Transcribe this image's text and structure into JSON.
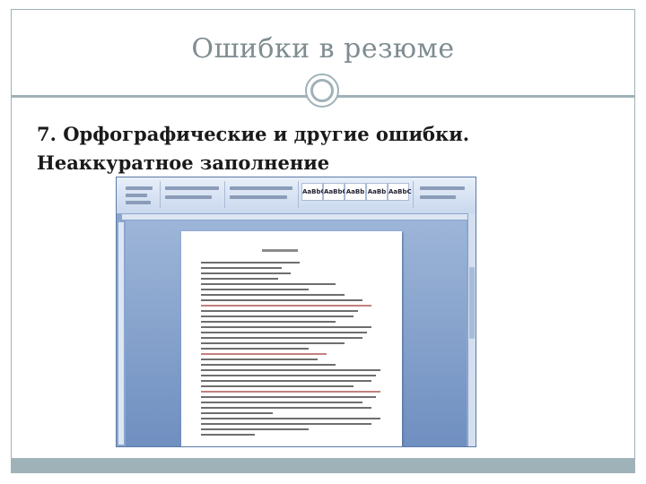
{
  "slide": {
    "title": "Ошибки в резюме",
    "heading_line1": "7. Орфографические и другие ошибки.",
    "heading_line2": "Неаккуратное заполнение"
  },
  "embedded_screenshot": {
    "application": "word-processor",
    "style_gallery": [
      "AaBbC",
      "AaBbC",
      "AaBb",
      "AaBb",
      "AaBbC"
    ]
  },
  "colors": {
    "accent": "#9fb2b8",
    "title_text": "#7f8c90",
    "heading_text": "#1a1a1a"
  }
}
